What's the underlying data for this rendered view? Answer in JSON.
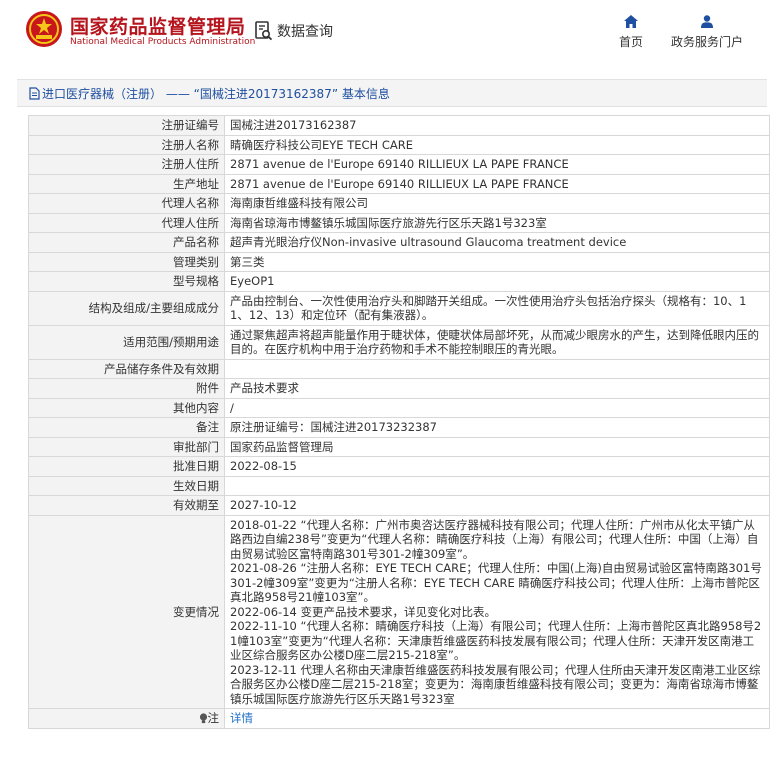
{
  "header": {
    "site_name_cn": "国家药品监督管理局",
    "site_name_en": "National Medical Products Administration",
    "data_query_label": "数据查询",
    "nav": [
      {
        "label": "首页",
        "icon": "home-icon"
      },
      {
        "label": "政务服务门户",
        "icon": "user-icon"
      }
    ]
  },
  "title_bar": {
    "text": "进口医疗器械（注册） —— “国械注进20173162387” 基本信息",
    "icon": "document-icon"
  },
  "rows": [
    {
      "label": "注册证编号",
      "value": "国械注进20173162387"
    },
    {
      "label": "注册人名称",
      "value": "睛确医疗科技公司EYE TECH CARE"
    },
    {
      "label": "注册人住所",
      "value": "2871 avenue de l'Europe 69140 RILLIEUX LA PAPE FRANCE"
    },
    {
      "label": "生产地址",
      "value": "2871 avenue de l'Europe 69140 RILLIEUX LA PAPE FRANCE"
    },
    {
      "label": "代理人名称",
      "value": "海南康哲维盛科技有限公司"
    },
    {
      "label": "代理人住所",
      "value": "海南省琼海市博鳌镇乐城国际医疗旅游先行区乐天路1号323室"
    },
    {
      "label": "产品名称",
      "value": "超声青光眼治疗仪Non-invasive ultrasound Glaucoma treatment device"
    },
    {
      "label": "管理类别",
      "value": "第三类"
    },
    {
      "label": "型号规格",
      "value": "EyeOP1"
    },
    {
      "label": "结构及组成/主要组成成分",
      "value": "产品由控制台、一次性使用治疗头和脚踏开关组成。一次性使用治疗头包括治疗探头（规格有：10、11、12、13）和定位环（配有集液器）。"
    },
    {
      "label": "适用范围/预期用途",
      "value": "通过聚焦超声将超声能量作用于睫状体，使睫状体局部坏死，从而减少眼房水的产生，达到降低眼内压的目的。在医疗机构中用于治疗药物和手术不能控制眼压的青光眼。"
    },
    {
      "label": "产品储存条件及有效期",
      "value": ""
    },
    {
      "label": "附件",
      "value": "产品技术要求"
    },
    {
      "label": "其他内容",
      "value": "/"
    },
    {
      "label": "备注",
      "value": "原注册证编号：国械注进20173232387"
    },
    {
      "label": "审批部门",
      "value": "国家药品监督管理局"
    },
    {
      "label": "批准日期",
      "value": "2022-08-15"
    },
    {
      "label": "生效日期",
      "value": ""
    },
    {
      "label": "有效期至",
      "value": "2027-10-12"
    }
  ],
  "changes": {
    "label": "变更情况",
    "lines": [
      "2018-01-22 “代理人名称：广州市奥咨达医疗器械科技有限公司；代理人住所：广州市从化太平镇广从路西边自编238号”变更为“代理人名称：睛确医疗科技（上海）有限公司；代理人住所：中国（上海）自由贸易试验区富特南路301号301-2幢309室”。",
      "2021-08-26 “注册人名称：EYE TECH CARE；代理人住所：中国(上海)自由贸易试验区富特南路301号301-2幢309室”变更为“注册人名称：EYE TECH CARE 睛确医疗科技公司；代理人住所：上海市普陀区真北路958号21幢103室”。",
      "2022-06-14 变更产品技术要求，详见变化对比表。",
      "2022-11-10 “代理人名称：睛确医疗科技（上海）有限公司；代理人住所：上海市普陀区真北路958号21幢103室”变更为“代理人名称：天津康哲维盛医药科技发展有限公司；代理人住所：天津开发区南港工业区综合服务区办公楼D座二层215-218室”。",
      "2023-12-11 代理人名称由天津康哲维盛医药科技发展有限公司；代理人住所由天津开发区南港工业区综合服务区办公楼D座二层215-218室；变更为：海南康哲维盛科技有限公司；变更为：海南省琼海市博鳌镇乐城国际医疗旅游先行区乐天路1号323室"
    ]
  },
  "note_row": {
    "label": "注",
    "icon": "lightbulb-icon",
    "link_text": "详情"
  }
}
